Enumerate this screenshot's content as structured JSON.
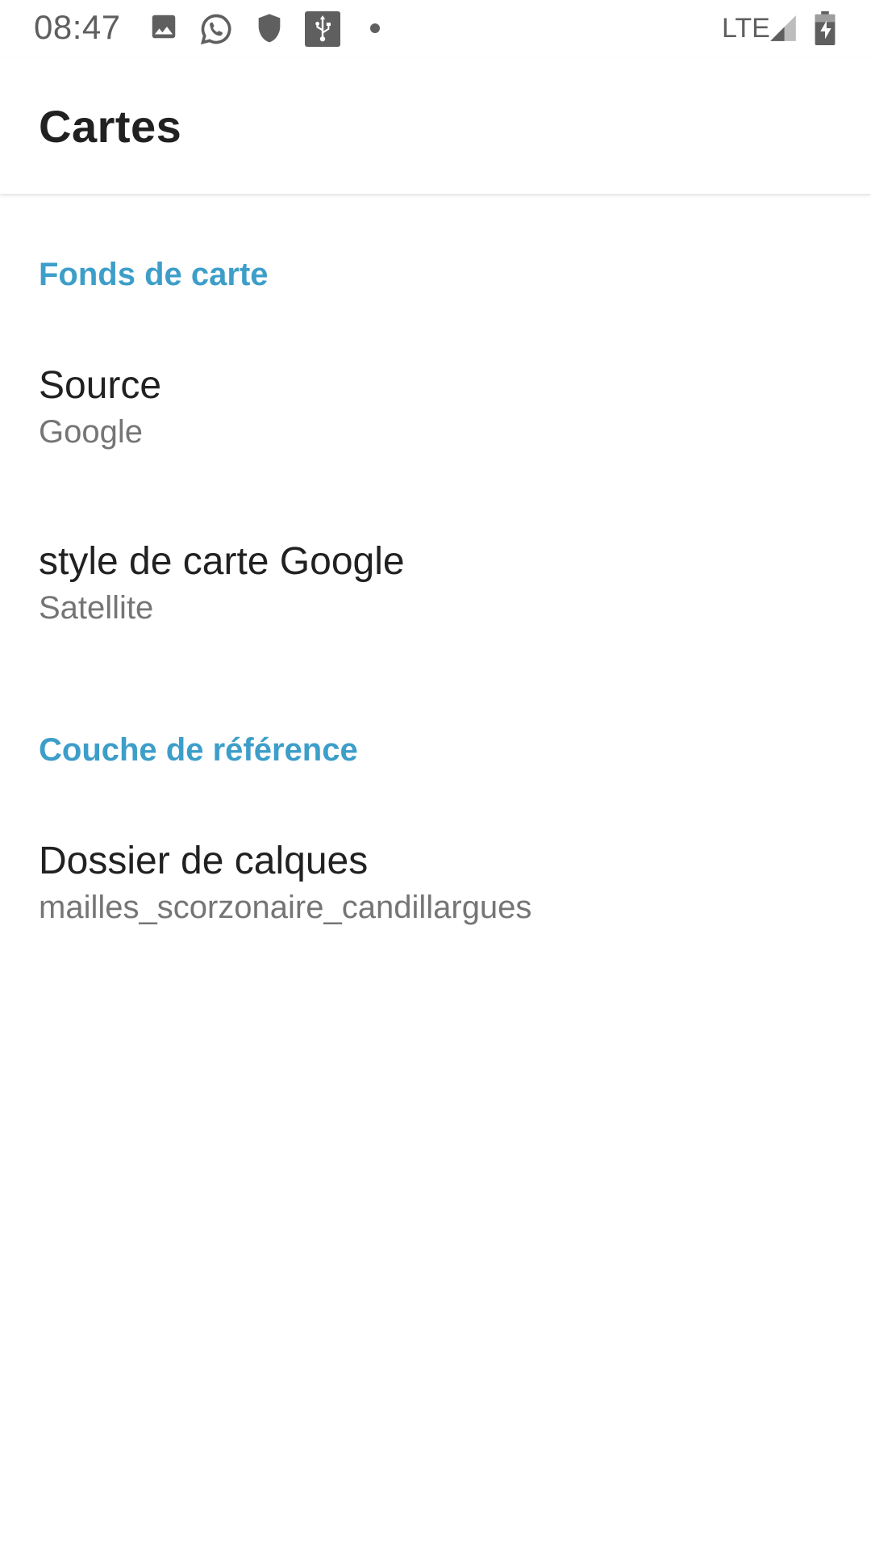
{
  "status_bar": {
    "time": "08:47",
    "network": "LTE",
    "icons": [
      "image-icon",
      "whatsapp-icon",
      "shield-icon",
      "usb-icon",
      "dot-icon",
      "signal-icon",
      "battery-charging-icon"
    ]
  },
  "app_bar": {
    "title": "Cartes"
  },
  "sections": [
    {
      "header": "Fonds de carte",
      "items": [
        {
          "title": "Source",
          "summary": "Google"
        },
        {
          "title": "style de carte Google",
          "summary": "Satellite"
        }
      ]
    },
    {
      "header": "Couche de référence",
      "items": [
        {
          "title": "Dossier de calques",
          "summary": "mailles_scorzonaire_candillargues"
        }
      ]
    }
  ],
  "colors": {
    "accent": "#3d9ec9",
    "title_text": "#212121",
    "summary_text": "#757575"
  }
}
